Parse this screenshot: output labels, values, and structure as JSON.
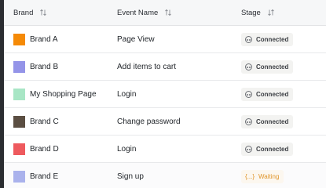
{
  "table": {
    "columns": [
      {
        "label": "Brand",
        "sort_icon": "sort-updown-icon"
      },
      {
        "label": "Event Name",
        "sort_icon": "sort-updown-icon"
      },
      {
        "label": "Stage",
        "sort_icon": "sort-desc-icon"
      }
    ],
    "rows": [
      {
        "brand": "Brand A",
        "color": "#f58a07",
        "event": "Page View",
        "stage": "Connected",
        "stage_icon": "plug-icon"
      },
      {
        "brand": "Brand B",
        "color": "#9494e8",
        "event": "Add items to cart",
        "stage": "Connected",
        "stage_icon": "plug-icon"
      },
      {
        "brand": "My Shopping Page",
        "color": "#a8e6c5",
        "event": "Login",
        "stage": "Connected",
        "stage_icon": "plug-icon"
      },
      {
        "brand": "Brand C",
        "color": "#5b4e42",
        "event": "Change password",
        "stage": "Connected",
        "stage_icon": "plug-icon"
      },
      {
        "brand": "Brand D",
        "color": "#ee5a5e",
        "event": "Login",
        "stage": "Connected",
        "stage_icon": "plug-icon"
      },
      {
        "brand": "Brand E",
        "color": "#aab2ec",
        "event": "Sign up",
        "stage": "Waiting",
        "stage_icon": "braces-icon",
        "stage_icon_glyph": "{...}"
      }
    ]
  },
  "colors": {
    "connected_text": "#3c3f44",
    "waiting_text": "#e0962d",
    "header_bg": "#f6f7f8"
  }
}
